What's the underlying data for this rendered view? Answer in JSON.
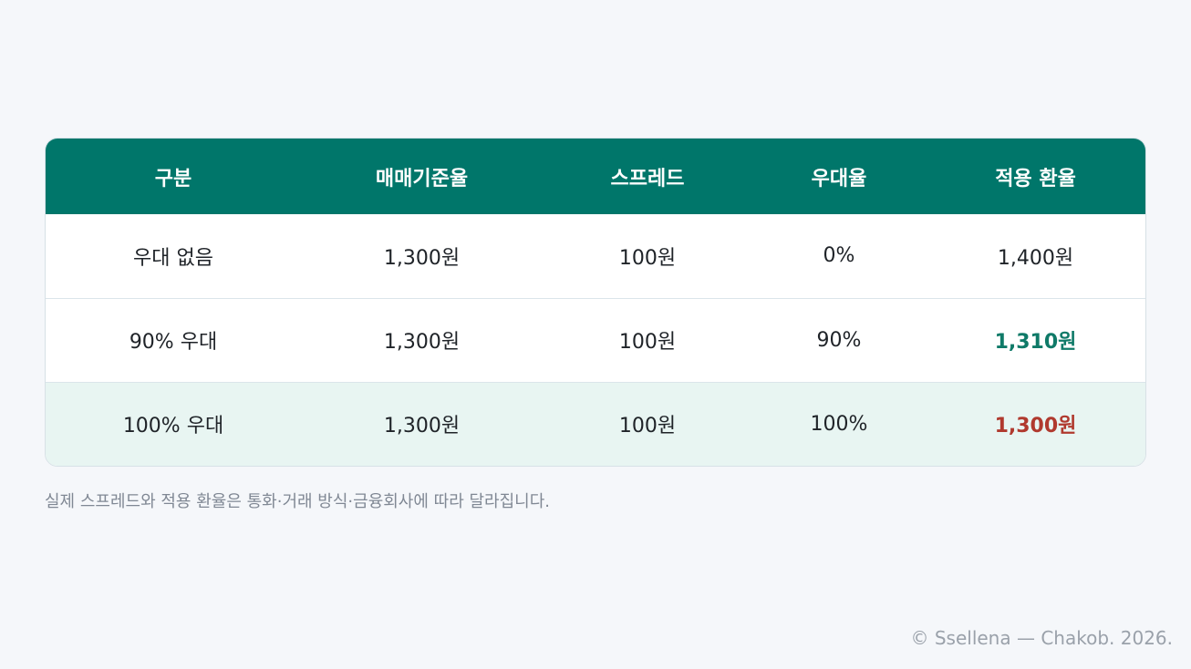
{
  "table": {
    "headers": [
      "구분",
      "매매기준율",
      "스프레드",
      "우대율",
      "적용 환율"
    ],
    "rows": [
      [
        "우대 없음",
        "1,300원",
        "100원",
        "0%",
        "1,400원"
      ],
      [
        "90% 우대",
        "1,300원",
        "100원",
        "90%",
        "1,310원"
      ],
      [
        "100% 우대",
        "1,300원",
        "100원",
        "100%",
        "1,300원"
      ]
    ]
  },
  "footnote": "실제 스프레드와 적용 환율은 통화·거래 방식·금융회사에 따라 달라집니다.",
  "copyright": "© Ssellena — Chakob. 2026.",
  "colors": {
    "header_bg": "#00766a",
    "page_bg": "#f5f7fa",
    "highlight_row_bg": "#e8f5f2",
    "green_text": "#0f7a68",
    "red_text": "#b0392e"
  }
}
